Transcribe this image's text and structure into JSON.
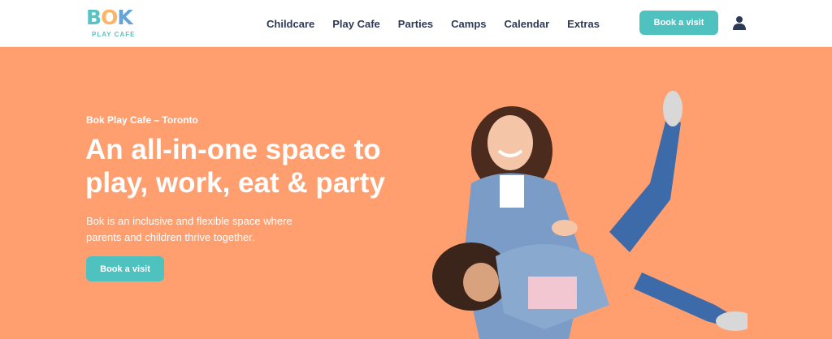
{
  "brand": {
    "word_b": "B",
    "word_o": "O",
    "word_k": "K",
    "tagline": "PLAY CAFE"
  },
  "nav": {
    "items": [
      {
        "label": "Childcare"
      },
      {
        "label": "Play Cafe"
      },
      {
        "label": "Parties"
      },
      {
        "label": "Camps"
      },
      {
        "label": "Calendar"
      },
      {
        "label": "Extras"
      }
    ],
    "book_label": "Book a visit",
    "user_icon": "user-icon"
  },
  "hero": {
    "eyebrow": "Bok Play Cafe – Toronto",
    "headline_line1": "An all-in-one space to",
    "headline_line2": "play, work, eat & party",
    "description_line1": "Bok is an inclusive and flexible space where",
    "description_line2": "parents and children thrive together.",
    "button_label": "Book a visit"
  },
  "colors": {
    "hero_bg": "#ff9f70",
    "accent": "#4fc2bf",
    "nav_text": "#2d3a57"
  }
}
